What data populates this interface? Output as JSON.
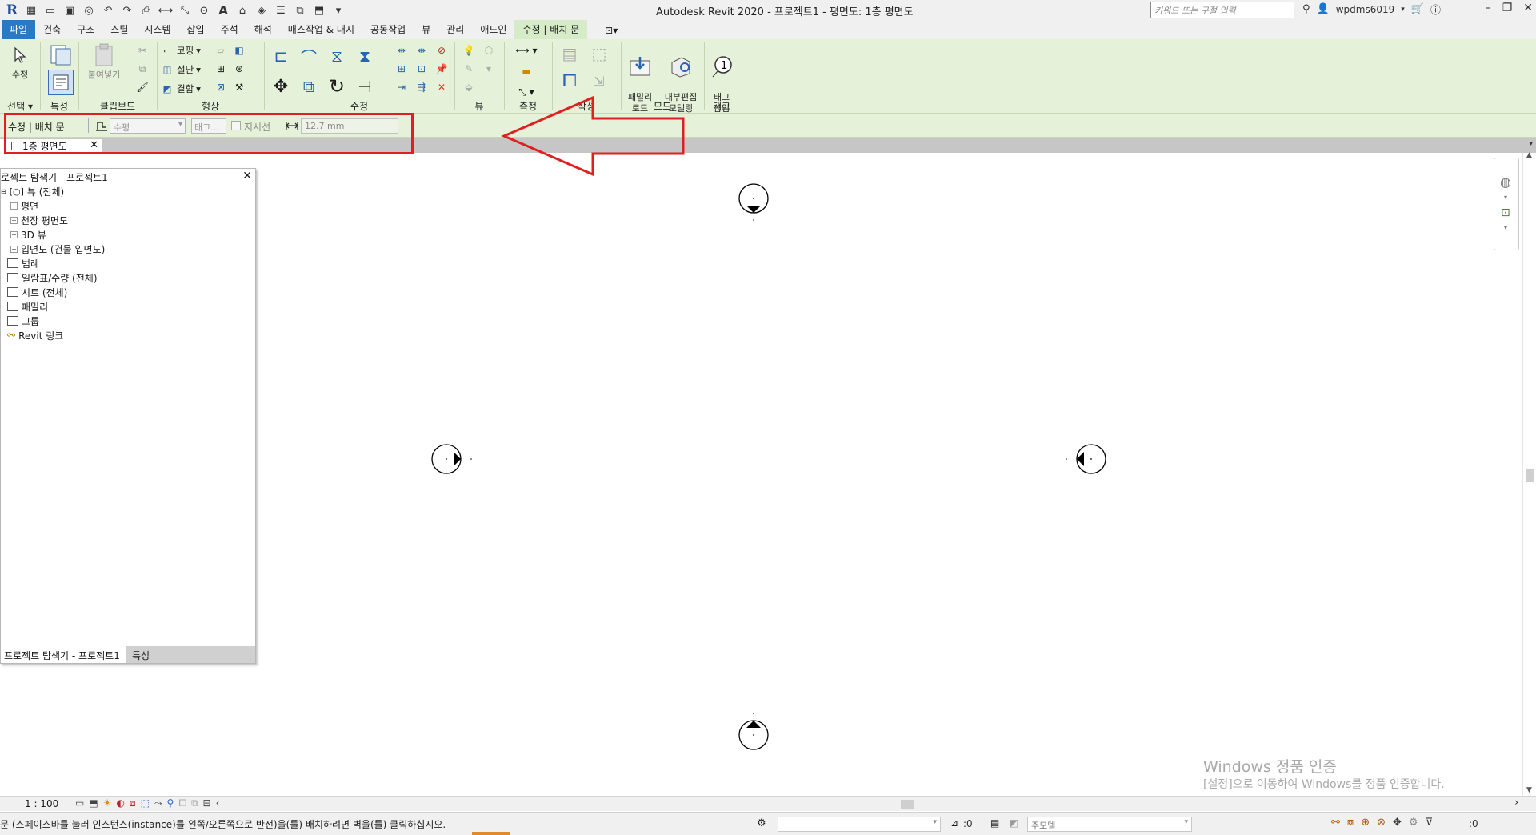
{
  "titlebar": {
    "app_letter": "R",
    "title": "Autodesk Revit 2020 - 프로젝트1 - 평면도: 1층 평면도",
    "search_placeholder": "키워드 또는 구절 입력",
    "user": "wpdms6019"
  },
  "tabs": [
    "파일",
    "건축",
    "구조",
    "스틸",
    "시스템",
    "삽입",
    "주석",
    "해석",
    "매스작업 & 대지",
    "공동작업",
    "뷰",
    "관리",
    "애드인",
    "수정 | 배치 문"
  ],
  "active_tab": "수정 | 배치 문",
  "ribbon": {
    "select": {
      "modify": "수정",
      "panel": "선택"
    },
    "properties": {
      "panel": "특성"
    },
    "clipboard": {
      "paste": "붙여넣기",
      "panel": "클립보드"
    },
    "geometry": {
      "cope": "코핑",
      "cut": "절단",
      "join": "결합",
      "panel": "형상"
    },
    "modify": {
      "panel": "수정"
    },
    "view": {
      "panel": "뷰"
    },
    "measure": {
      "panel": "측정"
    },
    "create": {
      "panel": "작성"
    },
    "mode": {
      "load_family": "패밀리\n로드",
      "inplace": "내부편집\n모델링",
      "panel": "모드"
    },
    "tag": {
      "tag_on_place": "태그\n삽입",
      "panel": "태그"
    }
  },
  "options_bar": {
    "context": "수정 | 배치 문",
    "orientation": "수평",
    "tag": "태그...",
    "leader_label": "지시선",
    "leader_checked": false,
    "length": "12.7 mm"
  },
  "view_tab": {
    "label": "1층 평면도"
  },
  "project_browser": {
    "title": "로젝트 탐색기 - 프로젝트1",
    "items": [
      {
        "label": "뷰 (전체)",
        "level": 0,
        "expander": "-"
      },
      {
        "label": "평면",
        "level": 1,
        "expander": "+"
      },
      {
        "label": "천장 평면도",
        "level": 1,
        "expander": "+"
      },
      {
        "label": "3D 뷰",
        "level": 1,
        "expander": "+"
      },
      {
        "label": "입면도 (건물 입면도)",
        "level": 1,
        "expander": "+"
      },
      {
        "label": "범례",
        "level": 0,
        "expander": ""
      },
      {
        "label": "일람표/수량 (전체)",
        "level": 0,
        "expander": ""
      },
      {
        "label": "시트 (전체)",
        "level": 0,
        "expander": ""
      },
      {
        "label": "패밀리",
        "level": 0,
        "expander": ""
      },
      {
        "label": "그룹",
        "level": 0,
        "expander": ""
      },
      {
        "label": "Revit 링크",
        "level": 0,
        "expander": ""
      }
    ],
    "tab_browser": "프로젝트 탐색기 - 프로젝트1",
    "tab_properties": "특성"
  },
  "watermark": {
    "line1": "Windows 정품 인증",
    "line2": "[설정]으로 이동하여 Windows를 정품 인증합니다."
  },
  "view_control": {
    "scale": "1 : 100"
  },
  "status": {
    "message": "문 (스페이스바를 눌러 인스턴스(instance)를 왼쪽/오른쪽으로 반전)을(를) 배치하려면 벽을(를) 클릭하십시오.",
    "zero1": ":0",
    "model": "주모델",
    "zero2": ":0"
  },
  "colors": {
    "ribbon": "#e6f1d9",
    "file_tab": "#2b78c5",
    "callout": "#e02020"
  }
}
